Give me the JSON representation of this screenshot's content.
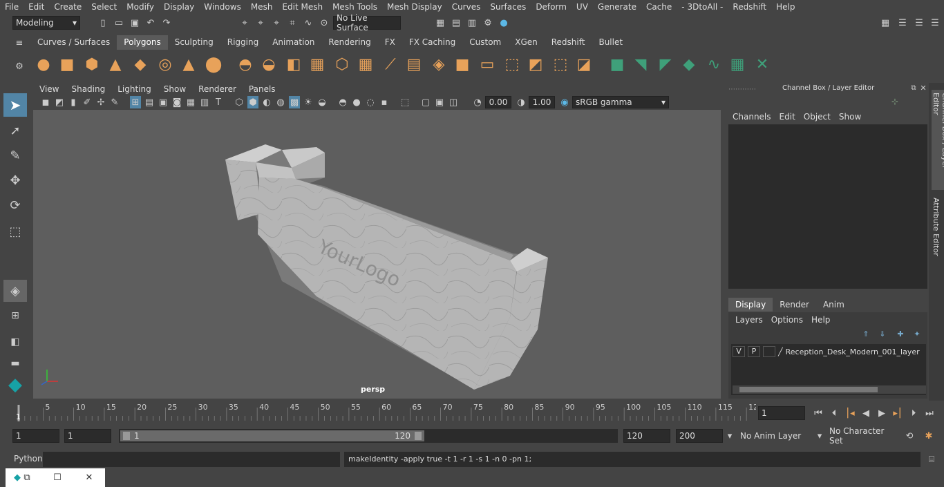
{
  "menu": [
    "File",
    "Edit",
    "Create",
    "Select",
    "Modify",
    "Display",
    "Windows",
    "Mesh",
    "Edit Mesh",
    "Mesh Tools",
    "Mesh Display",
    "Curves",
    "Surfaces",
    "Deform",
    "UV",
    "Generate",
    "Cache",
    "- 3DtoAll -",
    "Redshift",
    "Help"
  ],
  "status": {
    "mode": "Modeling",
    "live_surface": "No Live Surface"
  },
  "shelf_tabs": [
    "Curves / Surfaces",
    "Polygons",
    "Sculpting",
    "Rigging",
    "Animation",
    "Rendering",
    "FX",
    "FX Caching",
    "Custom",
    "XGen",
    "Redshift",
    "Bullet"
  ],
  "active_shelf": "Polygons",
  "viewport_menu": [
    "View",
    "Shading",
    "Lighting",
    "Show",
    "Renderer",
    "Panels"
  ],
  "viewport": {
    "exposure": "0.00",
    "gamma": "1.00",
    "color_space": "sRGB gamma",
    "camera": "persp",
    "logo_text": "YourLogo"
  },
  "channel_box": {
    "title": "Channel Box / Layer Editor",
    "menu": [
      "Channels",
      "Edit",
      "Object",
      "Show"
    ]
  },
  "layer_tabs": [
    "Display",
    "Render",
    "Anim"
  ],
  "layer_menu": [
    "Layers",
    "Options",
    "Help"
  ],
  "layer": {
    "v": "V",
    "p": "P",
    "name": "Reception_Desk_Modern_001_layer"
  },
  "side_tabs": [
    "Channel Box / Layer Editor",
    "Attribute Editor"
  ],
  "timeline": {
    "ticks": [
      "5",
      "10",
      "15",
      "20",
      "25",
      "30",
      "35",
      "40",
      "45",
      "50",
      "55",
      "60",
      "65",
      "70",
      "75",
      "80",
      "85",
      "90",
      "95",
      "100",
      "105",
      "110",
      "115",
      "12"
    ],
    "start_label": "1",
    "current_frame": "1"
  },
  "range": {
    "start": "1",
    "anim_start": "1",
    "slider_start": "1",
    "slider_end": "120",
    "end": "120",
    "anim_end": "200",
    "anim_layer": "No Anim Layer",
    "char_set": "No Character Set"
  },
  "cmd": {
    "lang": "Python",
    "output": "makeIdentity -apply true -t 1 -r 1 -s 1 -n 0 -pn 1;"
  },
  "colors": {
    "accent": "#5285a6",
    "shelf_orange": "#e8a25a",
    "shelf_green": "#3fa07a"
  }
}
